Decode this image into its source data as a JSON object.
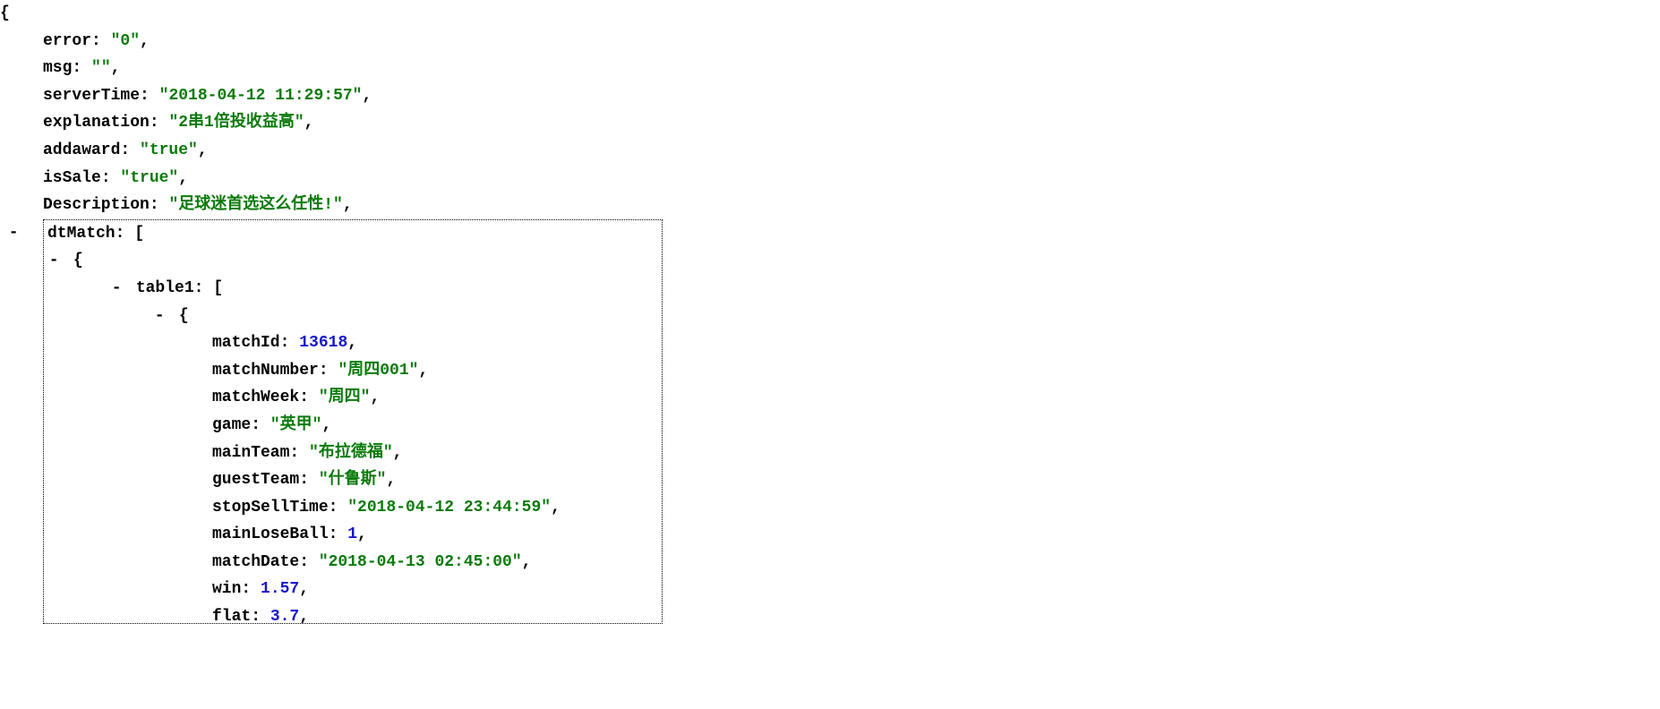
{
  "kv": {
    "error": {
      "key": "error",
      "value": "\"0\""
    },
    "msg": {
      "key": "msg",
      "value": "\"\""
    },
    "serverTime": {
      "key": "serverTime",
      "value": "\"2018-04-12 11:29:57\""
    },
    "explanation": {
      "key": "explanation",
      "value": "\"2串1倍投收益高\""
    },
    "addaward": {
      "key": "addaward",
      "value": "\"true\""
    },
    "isSale": {
      "key": "isSale",
      "value": "\"true\""
    },
    "Description": {
      "key": "Description",
      "value": "\"足球迷首选这么任性!\""
    }
  },
  "dtMatch": {
    "key": "dtMatch",
    "table1": {
      "key": "table1",
      "item": {
        "matchId": {
          "key": "matchId",
          "value": "13618"
        },
        "matchNumber": {
          "key": "matchNumber",
          "value": "\"周四001\""
        },
        "matchWeek": {
          "key": "matchWeek",
          "value": "\"周四\""
        },
        "game": {
          "key": "game",
          "value": "\"英甲\""
        },
        "mainTeam": {
          "key": "mainTeam",
          "value": "\"布拉德福\""
        },
        "guestTeam": {
          "key": "guestTeam",
          "value": "\"什鲁斯\""
        },
        "stopSellTime": {
          "key": "stopSellTime",
          "value": "\"2018-04-12 23:44:59\""
        },
        "mainLoseBall": {
          "key": "mainLoseBall",
          "value": "1"
        },
        "matchDate": {
          "key": "matchDate",
          "value": "\"2018-04-13 02:45:00\""
        },
        "win": {
          "key": "win",
          "value": "1.57"
        },
        "flat": {
          "key": "flat",
          "value": "3.7"
        }
      }
    }
  },
  "punct": {
    "open_brace": "{",
    "close_brace": "}",
    "open_bracket": "[",
    "close_bracket": "]",
    "colon": ":",
    "comma": ",",
    "minus": "-"
  }
}
